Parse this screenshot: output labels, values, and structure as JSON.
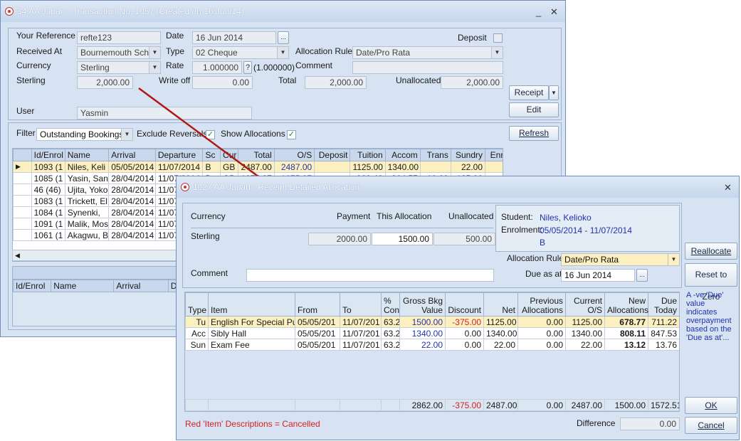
{
  "main_window": {
    "title": "34 AA Japan - Transaction No. 1057 (Created on 16/Jun/14)",
    "your_reference_label": "Your Reference",
    "your_reference": "refte123",
    "date_label": "Date",
    "date": "16 Jun 2014",
    "deposit_label": "Deposit",
    "received_at_label": "Received At",
    "received_at": "Bournemouth School",
    "type_label": "Type",
    "type": "02 Cheque",
    "allocation_rule_label": "Allocation Rule",
    "allocation_rule": "Date/Pro Rata",
    "currency_label": "Currency",
    "currency": "Sterling",
    "rate_label": "Rate",
    "rate": "1.000000",
    "rate_help": "?",
    "rate_inverse": "(1.000000)",
    "comment_label": "Comment",
    "sterling_label": "Sterling",
    "sterling": "2,000.00",
    "write_off_label": "Write off",
    "write_off": "0.00",
    "total_label": "Total",
    "total": "2,000.00",
    "unallocated_label": "Unallocated",
    "unallocated": "2,000.00",
    "receipt_button": "Receipt",
    "edit_button": "Edit",
    "user_label": "User",
    "user": "Yasmin",
    "filter_label": "Filter",
    "filter": "Outstanding Bookings",
    "exclude_reversals_label": "Exclude Reversals",
    "show_allocations_label": "Show Allocations",
    "refresh_button": "Refresh",
    "grid_columns": [
      "Id/Enrol",
      "Name",
      "Arrival",
      "Departure",
      "Sc",
      "Cur",
      "Total",
      "O/S",
      "Deposit",
      "Tuition",
      "Accom",
      "Trans",
      "Sundry",
      "Enro"
    ],
    "grid_rows": [
      [
        "1093 (1",
        "Niles, Keli",
        "05/05/2014",
        "11/07/2014",
        "B",
        "GB",
        "2487.00",
        "2487.00",
        "",
        "1125.00",
        "1340.00",
        "",
        "22.00",
        ""
      ],
      [
        "1085 (1",
        "Yasin, San",
        "28/04/2014",
        "11/07/2014",
        "B",
        "GB",
        "1075.87",
        "1075.87",
        "",
        "900.40",
        "264.57",
        "10.00",
        "125.00",
        ""
      ],
      [
        "46 (46)",
        "Ujita, Yoko",
        "28/04/2014",
        "11/07/2",
        "",
        "",
        "",
        "",
        "",
        "",
        "",
        "",
        "",
        ""
      ],
      [
        "1083 (1",
        "Trickett, El",
        "28/04/2014",
        "11/07/2",
        "",
        "",
        "",
        "",
        "",
        "",
        "",
        "",
        "",
        ""
      ],
      [
        "1084 (1",
        "Synenki,",
        "28/04/2014",
        "11/07/2",
        "",
        "",
        "",
        "",
        "",
        "",
        "",
        "",
        "",
        ""
      ],
      [
        "1091 (1",
        "Malik, Mos",
        "28/04/2014",
        "11/07/2",
        "",
        "",
        "",
        "",
        "",
        "",
        "",
        "",
        "",
        ""
      ],
      [
        "1061 (1",
        "Akagwu, B",
        "28/04/2014",
        "11/07/2",
        "",
        "",
        "",
        "",
        "",
        "",
        "",
        "",
        "",
        ""
      ]
    ],
    "lower_columns": [
      "Id/Enrol",
      "Name",
      "Arrival",
      "Departure"
    ]
  },
  "dialog": {
    "title": "1027 AA Japan - Receipt Detailed Allocation",
    "currency_label": "Currency",
    "payment_label": "Payment",
    "this_allocation_label": "This Allocation",
    "unallocated_label": "Unallocated",
    "sterling_label": "Sterling",
    "payment": "2000.00",
    "this_allocation": "1500.00",
    "unallocated": "500.00",
    "student_label": "Student:",
    "student": "Niles, Kelioko",
    "enrolment_label": "Enrolment:",
    "enrolment": "05/05/2014 - 11/07/2014",
    "enrolment_code": "B",
    "allocation_rule_label": "Allocation Rule",
    "allocation_rule": "Date/Pro Rata",
    "comment_label": "Comment",
    "due_as_at_label": "Due as at",
    "due_as_at": "16 Jun 2014",
    "reallocate_button": "Reallocate",
    "reset_button": "Reset to Zero",
    "note": "A -ve 'Due' value indicates overpayment based on the 'Due as at'...",
    "ok_button": "OK",
    "cancel_button": "Cancel",
    "grid_columns": [
      "Type",
      "Item",
      "From",
      "To",
      "% Con",
      "Gross Bkg Value",
      "Discount",
      "Net",
      "Previous Allocations",
      "Current O/S",
      "New Allocations",
      "Due Today"
    ],
    "grid_rows": [
      [
        "Tu",
        "English For Special Pur",
        "05/05/201",
        "11/07/201",
        "63.2",
        "1500.00",
        "-375.00",
        "1125.00",
        "0.00",
        "1125.00",
        "678.77",
        "711.22"
      ],
      [
        "Acc",
        "Sibly Hall",
        "05/05/201",
        "11/07/201",
        "63.2",
        "1340.00",
        "0.00",
        "1340.00",
        "0.00",
        "1340.00",
        "808.11",
        "847.53"
      ],
      [
        "Sun",
        "Exam Fee",
        "05/05/201",
        "11/07/201",
        "63.2",
        "22.00",
        "0.00",
        "22.00",
        "0.00",
        "22.00",
        "13.12",
        "13.76"
      ]
    ],
    "totals": [
      "",
      "",
      "",
      "",
      "",
      "2862.00",
      "-375.00",
      "2487.00",
      "0.00",
      "2487.00",
      "1500.00",
      "1572.51"
    ],
    "legend": "Red 'Item' Descriptions = Cancelled",
    "difference_label": "Difference",
    "difference": "0.00"
  },
  "colors": {
    "accent_blue": "#2233aa",
    "cancel_red": "#d62020",
    "selection": "#fdf0c0",
    "arrow": "#b01818"
  }
}
